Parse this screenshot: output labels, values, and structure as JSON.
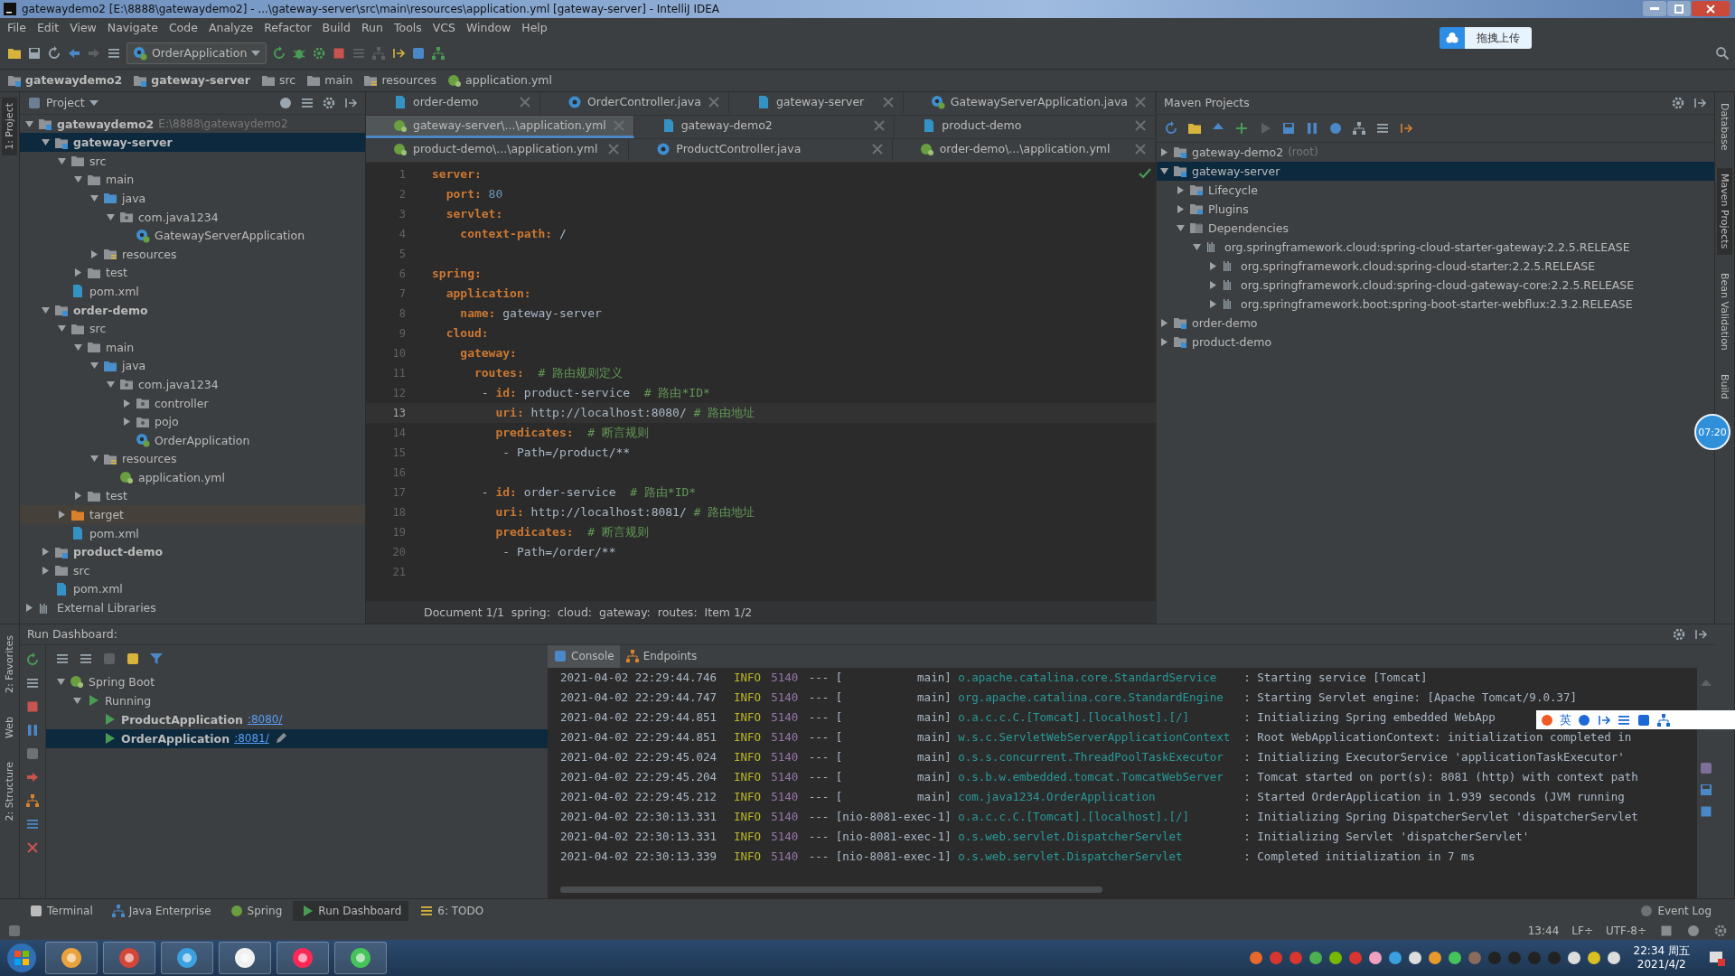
{
  "window": {
    "title": "gatewaydemo2 [E:\\8888\\gatewaydemo2] - ...\\gateway-server\\src\\main\\resources\\application.yml [gateway-server] - IntelliJ IDEA"
  },
  "menu": [
    "File",
    "Edit",
    "View",
    "Navigate",
    "Code",
    "Analyze",
    "Refactor",
    "Build",
    "Run",
    "Tools",
    "VCS",
    "Window",
    "Help"
  ],
  "toolbar": {
    "run_config": "OrderApplication"
  },
  "upload_button": "拖拽上传",
  "navigation": [
    {
      "label": "gatewaydemo2",
      "kind": "module"
    },
    {
      "label": "gateway-server",
      "kind": "module"
    },
    {
      "label": "src",
      "kind": "folder"
    },
    {
      "label": "main",
      "kind": "folder"
    },
    {
      "label": "resources",
      "kind": "resources"
    },
    {
      "label": "application.yml",
      "kind": "yaml"
    }
  ],
  "left_strip": [
    {
      "label": "1: Project",
      "selected": true
    }
  ],
  "project_panel": {
    "title": "Project",
    "tree": [
      {
        "label": "gatewaydemo2",
        "hint": "E:\\8888\\gatewaydemo2",
        "kind": "module",
        "expanded": true,
        "selected": false,
        "children": [
          {
            "label": "gateway-server",
            "kind": "module",
            "expanded": true,
            "selected": true,
            "children": [
              {
                "label": "src",
                "kind": "folder",
                "expanded": true,
                "selected": false,
                "children": [
                  {
                    "label": "main",
                    "kind": "folder",
                    "expanded": true,
                    "selected": false,
                    "children": [
                      {
                        "label": "java",
                        "kind": "source",
                        "expanded": true,
                        "selected": false,
                        "children": [
                          {
                            "label": "com.java1234",
                            "kind": "package",
                            "expanded": true,
                            "selected": false,
                            "children": [
                              {
                                "label": "GatewayServerApplication",
                                "kind": "spring-class",
                                "selected": false
                              }
                            ]
                          }
                        ]
                      },
                      {
                        "label": "resources",
                        "kind": "resources",
                        "expanded": false,
                        "selected": false
                      }
                    ]
                  },
                  {
                    "label": "test",
                    "kind": "folder",
                    "expanded": false,
                    "selected": false
                  }
                ]
              },
              {
                "label": "pom.xml",
                "kind": "maven",
                "selected": false
              }
            ]
          },
          {
            "label": "order-demo",
            "kind": "module",
            "expanded": true,
            "selected": false,
            "children": [
              {
                "label": "src",
                "kind": "folder",
                "expanded": true,
                "selected": false,
                "children": [
                  {
                    "label": "main",
                    "kind": "folder",
                    "expanded": true,
                    "selected": false,
                    "children": [
                      {
                        "label": "java",
                        "kind": "source",
                        "expanded": true,
                        "selected": false,
                        "children": [
                          {
                            "label": "com.java1234",
                            "kind": "package",
                            "expanded": true,
                            "selected": false,
                            "children": [
                              {
                                "label": "controller",
                                "kind": "package",
                                "expanded": false,
                                "selected": false
                              },
                              {
                                "label": "pojo",
                                "kind": "package",
                                "expanded": false,
                                "selected": false
                              },
                              {
                                "label": "OrderApplication",
                                "kind": "spring-class",
                                "selected": false
                              }
                            ]
                          }
                        ]
                      },
                      {
                        "label": "resources",
                        "kind": "resources",
                        "expanded": true,
                        "selected": false,
                        "children": [
                          {
                            "label": "application.yml",
                            "kind": "yaml",
                            "selected": false
                          }
                        ]
                      }
                    ]
                  },
                  {
                    "label": "test",
                    "kind": "folder",
                    "expanded": false,
                    "selected": false
                  }
                ]
              },
              {
                "label": "target",
                "kind": "excluded",
                "expanded": false,
                "selected": false
              },
              {
                "label": "pom.xml",
                "kind": "maven",
                "selected": false
              }
            ]
          },
          {
            "label": "product-demo",
            "kind": "module",
            "expanded": false,
            "selected": false
          },
          {
            "label": "src",
            "kind": "folder",
            "expanded": false,
            "selected": false
          },
          {
            "label": "pom.xml",
            "kind": "maven",
            "selected": false
          }
        ]
      },
      {
        "label": "External Libraries",
        "kind": "library",
        "expanded": false,
        "selected": false
      }
    ]
  },
  "editor": {
    "tab_rows": [
      [
        {
          "label": "order-demo",
          "kind": "maven",
          "selected": false
        },
        {
          "label": "OrderController.java",
          "kind": "class",
          "selected": false
        },
        {
          "label": "gateway-server",
          "kind": "maven",
          "selected": false
        },
        {
          "label": "GatewayServerApplication.java",
          "kind": "spring-class",
          "selected": false
        }
      ],
      [
        {
          "label": "gateway-server\\...\\application.yml",
          "kind": "yaml",
          "selected": true
        },
        {
          "label": "gateway-demo2",
          "kind": "maven",
          "selected": false
        },
        {
          "label": "product-demo",
          "kind": "maven",
          "selected": false
        }
      ],
      [
        {
          "label": "product-demo\\...\\application.yml",
          "kind": "yaml",
          "selected": false
        },
        {
          "label": "ProductController.java",
          "kind": "class",
          "selected": false
        },
        {
          "label": "order-demo\\...\\application.yml",
          "kind": "yaml",
          "selected": false
        }
      ]
    ],
    "lines": [
      {
        "number": "1",
        "current": false,
        "tokens": [
          {
            "kind": "key",
            "text": "server:"
          }
        ]
      },
      {
        "number": "2",
        "current": false,
        "tokens": [
          {
            "kind": "key",
            "text": "  port:"
          },
          {
            "kind": "number",
            "text": " 80"
          }
        ]
      },
      {
        "number": "3",
        "current": false,
        "tokens": [
          {
            "kind": "key",
            "text": "  servlet:"
          }
        ]
      },
      {
        "number": "4",
        "current": false,
        "tokens": [
          {
            "kind": "key",
            "text": "    context-path:"
          },
          {
            "kind": "value",
            "text": " /"
          }
        ]
      },
      {
        "number": "5",
        "current": false
      },
      {
        "number": "6",
        "current": false,
        "tokens": [
          {
            "kind": "key",
            "text": "spring:"
          }
        ]
      },
      {
        "number": "7",
        "current": false,
        "tokens": [
          {
            "kind": "key",
            "text": "  application:"
          }
        ]
      },
      {
        "number": "8",
        "current": false,
        "tokens": [
          {
            "kind": "key",
            "text": "    name:"
          },
          {
            "kind": "value",
            "text": " gateway-server"
          }
        ]
      },
      {
        "number": "9",
        "current": false,
        "tokens": [
          {
            "kind": "key",
            "text": "  cloud:"
          }
        ]
      },
      {
        "number": "10",
        "current": false,
        "tokens": [
          {
            "kind": "key",
            "text": "    gateway:"
          }
        ]
      },
      {
        "number": "11",
        "current": false,
        "tokens": [
          {
            "kind": "key",
            "text": "      routes:"
          },
          {
            "kind": "comment",
            "text": "  # 路由规则定义"
          }
        ]
      },
      {
        "number": "12",
        "current": false,
        "tokens": [
          {
            "kind": "value",
            "text": "       -"
          },
          {
            "kind": "key",
            "text": " id:"
          },
          {
            "kind": "value",
            "text": " product-service"
          },
          {
            "kind": "comment",
            "text": "  # 路由*ID*"
          }
        ]
      },
      {
        "number": "13",
        "current": true,
        "tokens": [
          {
            "kind": "key",
            "text": "         uri:"
          },
          {
            "kind": "value",
            "text": " http://localhost:8080/"
          },
          {
            "kind": "comment",
            "text": " # 路由地址"
          }
        ]
      },
      {
        "number": "14",
        "current": false,
        "tokens": [
          {
            "kind": "key",
            "text": "         predicates:"
          },
          {
            "kind": "comment",
            "text": "  # 断言规则"
          }
        ]
      },
      {
        "number": "15",
        "current": false,
        "tokens": [
          {
            "kind": "value",
            "text": "          - Path=/product/**"
          }
        ]
      },
      {
        "number": "16",
        "current": false
      },
      {
        "number": "17",
        "current": false,
        "tokens": [
          {
            "kind": "value",
            "text": "       -"
          },
          {
            "kind": "key",
            "text": " id:"
          },
          {
            "kind": "value",
            "text": " order-service"
          },
          {
            "kind": "comment",
            "text": "  # 路由*ID*"
          }
        ]
      },
      {
        "number": "18",
        "current": false,
        "tokens": [
          {
            "kind": "key",
            "text": "         uri:"
          },
          {
            "kind": "value",
            "text": " http://localhost:8081/"
          },
          {
            "kind": "comment",
            "text": " # 路由地址"
          }
        ]
      },
      {
        "number": "19",
        "current": false,
        "tokens": [
          {
            "kind": "key",
            "text": "         predicates:"
          },
          {
            "kind": "comment",
            "text": "  # 断言规则"
          }
        ]
      },
      {
        "number": "20",
        "current": false,
        "tokens": [
          {
            "kind": "value",
            "text": "          - Path=/order/**"
          }
        ]
      },
      {
        "number": "21",
        "current": false
      }
    ],
    "breadcrumb": [
      "Document 1/1",
      "spring:",
      "cloud:",
      "gateway:",
      "routes:",
      "Item 1/2"
    ]
  },
  "maven": {
    "title": "Maven Projects",
    "tree": [
      {
        "label": "gateway-demo2",
        "hint": "(root)",
        "kind": "maven-module",
        "expanded": false,
        "selected": false
      },
      {
        "label": "gateway-server",
        "kind": "maven-module",
        "expanded": true,
        "selected": true,
        "children": [
          {
            "label": "Lifecycle",
            "kind": "lifecycle",
            "expanded": false,
            "selected": false
          },
          {
            "label": "Plugins",
            "kind": "lifecycle",
            "expanded": false,
            "selected": false
          },
          {
            "label": "Dependencies",
            "kind": "dependencies",
            "expanded": true,
            "selected": false,
            "children": [
              {
                "label": "org.springframework.cloud:spring-cloud-starter-gateway:2.2.5.RELEASE",
                "kind": "library",
                "expanded": true,
                "selected": false,
                "children": [
                  {
                    "label": "org.springframework.cloud:spring-cloud-starter:2.2.5.RELEASE",
                    "kind": "library",
                    "expanded": false,
                    "selected": false
                  },
                  {
                    "label": "org.springframework.cloud:spring-cloud-gateway-core:2.2.5.RELEASE",
                    "kind": "library",
                    "expanded": false,
                    "selected": false
                  },
                  {
                    "label": "org.springframework.boot:spring-boot-starter-webflux:2.3.2.RELEASE",
                    "kind": "library",
                    "expanded": false,
                    "selected": false
                  }
                ]
              }
            ]
          }
        ]
      },
      {
        "label": "order-demo",
        "kind": "maven-module",
        "expanded": false,
        "selected": false
      },
      {
        "label": "product-demo",
        "kind": "maven-module",
        "expanded": false,
        "selected": false
      }
    ]
  },
  "right_strip": [
    {
      "label": "Database",
      "selected": false
    },
    {
      "label": "Maven Projects",
      "selected": true
    },
    {
      "label": "Bean Validation",
      "selected": false
    },
    {
      "label": "Build",
      "selected": false
    }
  ],
  "timer_badge": "07:20",
  "run_dashboard": {
    "title": "Run Dashboard:",
    "tree": [
      {
        "label": "Spring Boot",
        "kind": "spring-boot",
        "expanded": true,
        "selected": false,
        "children": [
          {
            "label": "Running",
            "kind": "run",
            "expanded": true,
            "selected": false,
            "children": [
              {
                "label": "ProductApplication",
                "link": ":8080/",
                "kind": "app",
                "selected": false
              },
              {
                "label": "OrderApplication",
                "link": ":8081/",
                "kind": "app",
                "selected": true
              }
            ]
          }
        ]
      }
    ],
    "console_tabs": [
      {
        "label": "Console",
        "selected": true
      },
      {
        "label": "Endpoints",
        "selected": false
      }
    ],
    "log": [
      {
        "time": "2021-04-02 22:29:44.746",
        "level": "INFO",
        "pid": "5140",
        "thread": "--- [           main]",
        "logger": "o.apache.catalina.core.StandardService",
        "message": ": Starting service [Tomcat]"
      },
      {
        "time": "2021-04-02 22:29:44.747",
        "level": "INFO",
        "pid": "5140",
        "thread": "--- [           main]",
        "logger": "org.apache.catalina.core.StandardEngine",
        "message": ": Starting Servlet engine: [Apache Tomcat/9.0.37]"
      },
      {
        "time": "2021-04-02 22:29:44.851",
        "level": "INFO",
        "pid": "5140",
        "thread": "--- [           main]",
        "logger": "o.a.c.c.C.[Tomcat].[localhost].[/]",
        "message": ": Initializing Spring embedded WebApp"
      },
      {
        "time": "2021-04-02 22:29:44.851",
        "level": "INFO",
        "pid": "5140",
        "thread": "--- [           main]",
        "logger": "w.s.c.ServletWebServerApplicationContext",
        "message": ": Root WebApplicationContext: initialization completed in"
      },
      {
        "time": "2021-04-02 22:29:45.024",
        "level": "INFO",
        "pid": "5140",
        "thread": "--- [           main]",
        "logger": "o.s.s.concurrent.ThreadPoolTaskExecutor",
        "message": ": Initializing ExecutorService 'applicationTaskExecutor'"
      },
      {
        "time": "2021-04-02 22:29:45.204",
        "level": "INFO",
        "pid": "5140",
        "thread": "--- [           main]",
        "logger": "o.s.b.w.embedded.tomcat.TomcatWebServer",
        "message": ": Tomcat started on port(s): 8081 (http) with context path"
      },
      {
        "time": "2021-04-02 22:29:45.212",
        "level": "INFO",
        "pid": "5140",
        "thread": "--- [           main]",
        "logger": "com.java1234.OrderApplication",
        "message": ": Started OrderApplication in 1.939 seconds (JVM running"
      },
      {
        "time": "2021-04-02 22:30:13.331",
        "level": "INFO",
        "pid": "5140",
        "thread": "--- [nio-8081-exec-1]",
        "logger": "o.a.c.c.C.[Tomcat].[localhost].[/]",
        "message": ": Initializing Spring DispatcherServlet 'dispatcherServlet"
      },
      {
        "time": "2021-04-02 22:30:13.331",
        "level": "INFO",
        "pid": "5140",
        "thread": "--- [nio-8081-exec-1]",
        "logger": "o.s.web.servlet.DispatcherServlet",
        "message": ": Initializing Servlet 'dispatcherServlet'"
      },
      {
        "time": "2021-04-02 22:30:13.339",
        "level": "INFO",
        "pid": "5140",
        "thread": "--- [nio-8081-exec-1]",
        "logger": "o.s.web.servlet.DispatcherServlet",
        "message": ": Completed initialization in 7 ms"
      }
    ]
  },
  "bottom_left_strip": [
    "2: Favorites",
    "Web",
    "2: Structure"
  ],
  "tool_tabs": [
    {
      "label": "Terminal",
      "selected": false
    },
    {
      "label": "Java Enterprise",
      "selected": false
    },
    {
      "label": "Spring",
      "selected": false
    },
    {
      "label": "Run Dashboard",
      "selected": true
    },
    {
      "label": "6: TODO",
      "selected": false
    }
  ],
  "status_bar": {
    "event_log": "Event Log",
    "position": "13:44",
    "line_separator": "LF÷",
    "encoding": "UTF-8÷"
  },
  "ime_bar": {
    "mode": "英"
  },
  "taskbar": {
    "time": "22:34 周五",
    "date": "2021/4/2"
  }
}
